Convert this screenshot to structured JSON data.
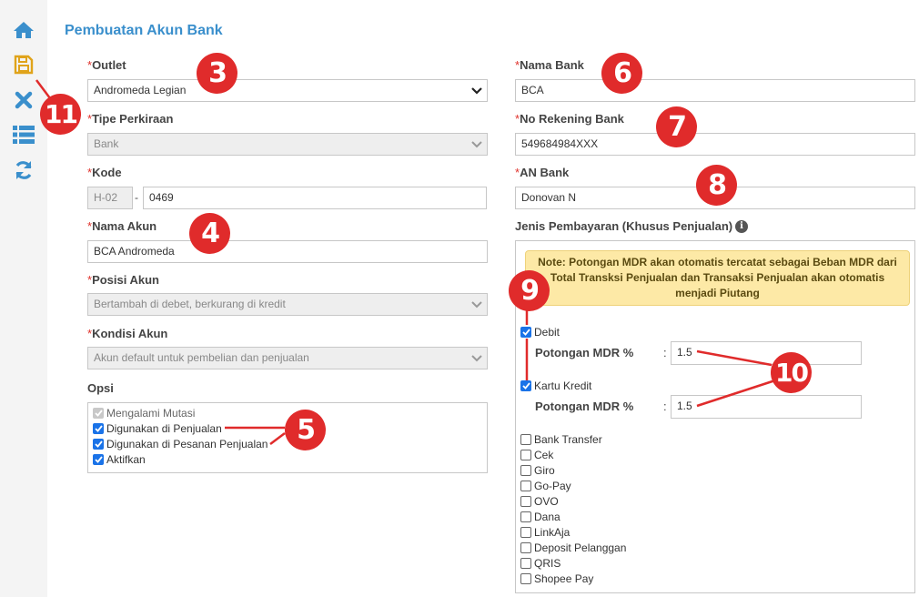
{
  "page": {
    "title": "Pembuatan Akun Bank"
  },
  "toolbar": {
    "icons": [
      "home-icon",
      "save-icon",
      "close-icon",
      "list-icon",
      "refresh-icon"
    ]
  },
  "form": {
    "outlet": {
      "label": "Outlet",
      "value": "Andromeda Legian"
    },
    "tipe_perkiraan": {
      "label": "Tipe Perkiraan",
      "value": "Bank"
    },
    "kode": {
      "label": "Kode",
      "prefix": "H-02",
      "separator": "-",
      "value": "0469"
    },
    "nama_akun": {
      "label": "Nama Akun",
      "value": "BCA Andromeda"
    },
    "posisi_akun": {
      "label": "Posisi Akun",
      "value": "Bertambah di debet, berkurang di kredit"
    },
    "kondisi_akun": {
      "label": "Kondisi Akun",
      "value": "Akun default untuk pembelian dan penjualan"
    },
    "opsi": {
      "label": "Opsi",
      "items": [
        {
          "label": "Mengalami Mutasi",
          "checked": true,
          "disabled": true
        },
        {
          "label": "Digunakan di Penjualan",
          "checked": true,
          "disabled": false
        },
        {
          "label": "Digunakan di Pesanan Penjualan",
          "checked": true,
          "disabled": false
        },
        {
          "label": "Aktifkan",
          "checked": true,
          "disabled": false
        }
      ]
    },
    "nama_bank": {
      "label": "Nama Bank",
      "value": "BCA"
    },
    "no_rekening": {
      "label": "No Rekening Bank",
      "value": "549684984XXX"
    },
    "an_bank": {
      "label": "AN Bank",
      "value": "Donovan N"
    },
    "required_mark": "*"
  },
  "pembayaran": {
    "label": "Jenis Pembayaran (Khusus Penjualan)",
    "info_icon": "i",
    "note": "Note: Potongan MDR akan otomatis tercatat sebagai Beban MDR dari Total Transksi Penjualan dan Transaksi Penjualan akan otomatis menjadi Piutang",
    "mdr_label": "Potongan MDR %",
    "colon": ":",
    "debit": {
      "label": "Debit",
      "checked": true,
      "mdr": "1.5"
    },
    "kartu_kredit": {
      "label": "Kartu Kredit",
      "checked": true,
      "mdr": "1.5"
    },
    "others": [
      "Bank Transfer",
      "Cek",
      "Giro",
      "Go-Pay",
      "OVO",
      "Dana",
      "LinkAja",
      "Deposit Pelanggan",
      "QRIS",
      "Shopee Pay"
    ]
  },
  "annotations": [
    "3",
    "4",
    "5",
    "6",
    "7",
    "8",
    "9",
    "10",
    "11"
  ],
  "colors": {
    "accent": "#3a8fcc",
    "badge": "#e02b2b",
    "note_bg": "#fde9a6",
    "checkbox": "#1a73e8"
  }
}
